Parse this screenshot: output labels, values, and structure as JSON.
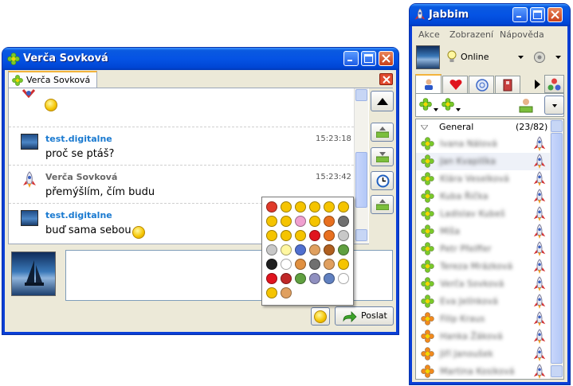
{
  "chat_window": {
    "title": "Verča Sovková",
    "tab_label": "Verča Sovková",
    "send_label": "Poslat",
    "messages": [
      {
        "sender": "test.digitalne",
        "time": "15:23:18",
        "text": "proč se ptáš?"
      },
      {
        "sender": "Verča Sovková",
        "time": "15:23:42",
        "text": "přemýšlím, čím budu"
      },
      {
        "sender": "test.digitalne",
        "time": "",
        "text": "buď sama sebou"
      }
    ],
    "colors": {
      "sender_self": "#1a7ad0",
      "sender_other": "#666666"
    }
  },
  "roster_window": {
    "title": "Jabbim",
    "menu": [
      "Akce",
      "Zobrazení",
      "Nápověda"
    ],
    "status": "Online",
    "group": {
      "name": "General",
      "count": "(23/82)"
    },
    "contacts": [
      {
        "name": "Ivana Nálová",
        "status_color": "#7ac82a"
      },
      {
        "name": "Jan Kvapilíka",
        "status_color": "#7ac82a"
      },
      {
        "name": "Klára Veselková",
        "status_color": "#7ac82a"
      },
      {
        "name": "Kuba Řička",
        "status_color": "#7ac82a"
      },
      {
        "name": "Ladislav Kubeš",
        "status_color": "#7ac82a"
      },
      {
        "name": "Míša",
        "status_color": "#7ac82a"
      },
      {
        "name": "Petr Pfeiffer",
        "status_color": "#7ac82a"
      },
      {
        "name": "Tereza Mrázková",
        "status_color": "#7ac82a"
      },
      {
        "name": "Verča Sovková",
        "status_color": "#7ac82a"
      },
      {
        "name": "Eva Jelínková",
        "status_color": "#7ac82a"
      },
      {
        "name": "Filip Kraus",
        "status_color": "#f08a1e"
      },
      {
        "name": "Hanka Žáková",
        "status_color": "#f08a1e"
      },
      {
        "name": "Jiří Janoušek",
        "status_color": "#f08a1e"
      },
      {
        "name": "Martina Kosiková",
        "status_color": "#f08a1e"
      }
    ]
  },
  "icons": [
    "flower-status-icon",
    "rocket-avatar-icon",
    "smiley-icon",
    "heart-icon",
    "arrow-up-icon",
    "clock-icon",
    "send-arrow-icon",
    "close-icon",
    "minimize-icon",
    "maximize-icon",
    "bulb-icon"
  ]
}
